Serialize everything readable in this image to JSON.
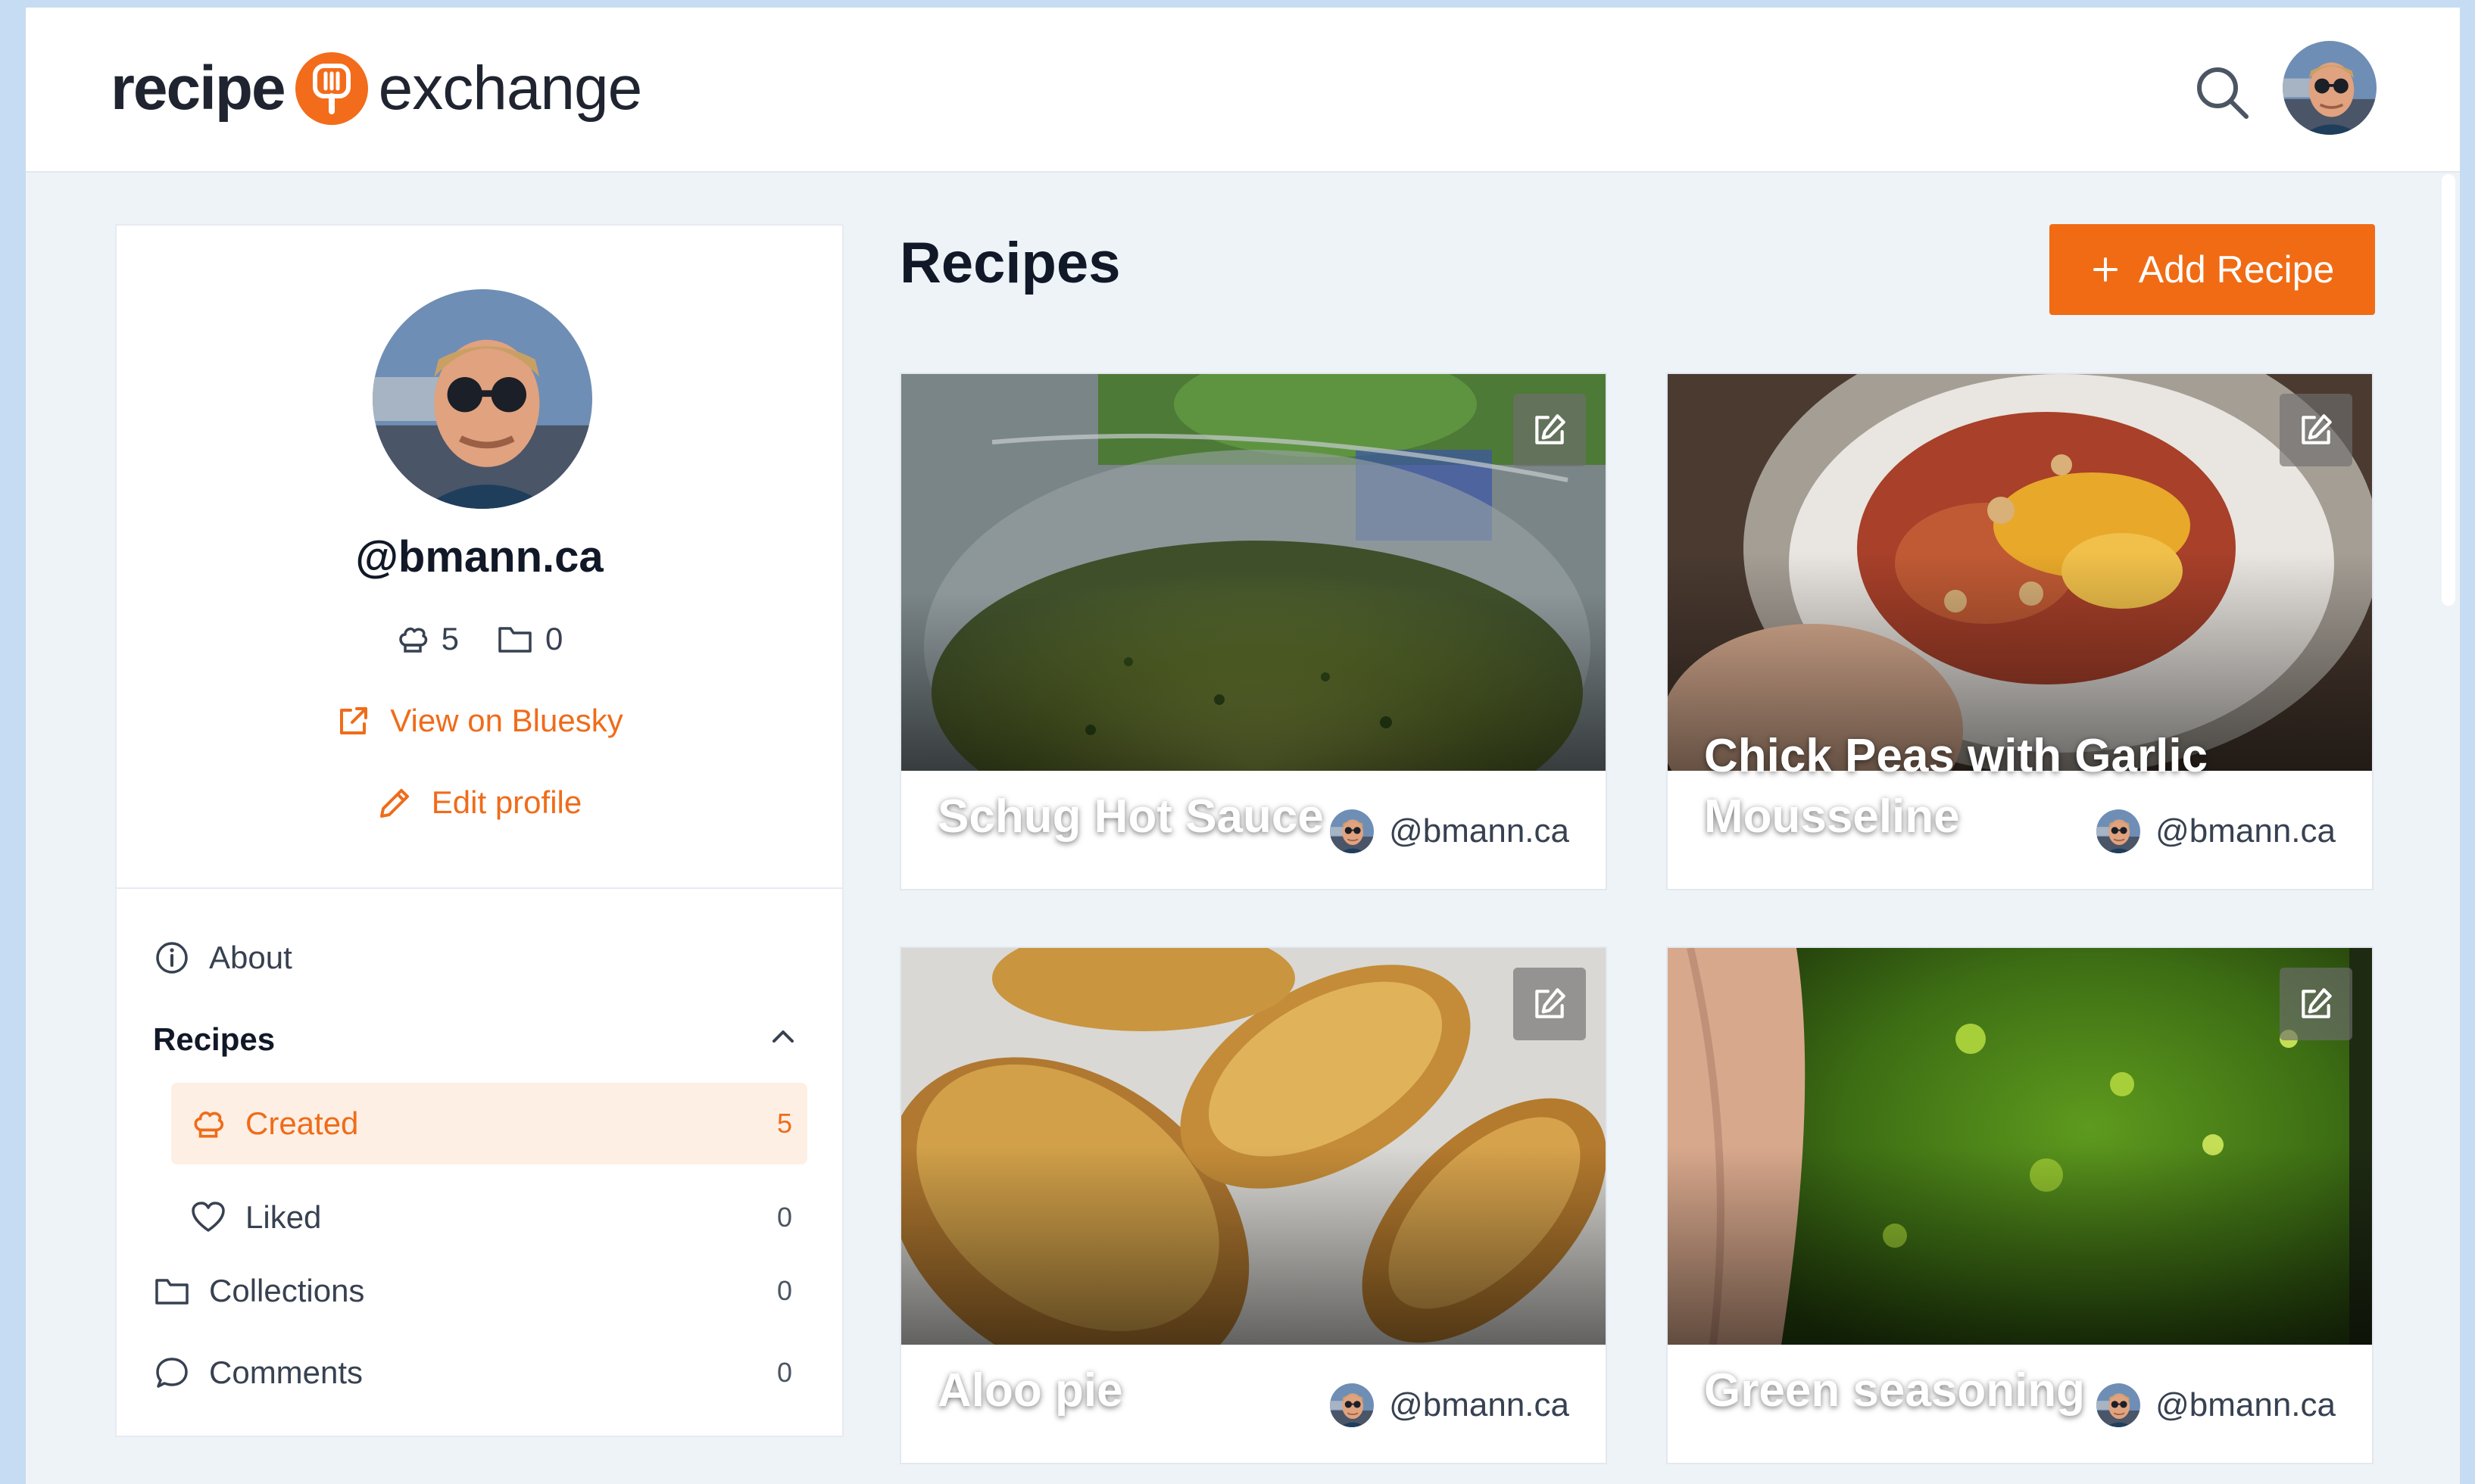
{
  "brand": {
    "word1": "recipe",
    "word2": "exchange",
    "accent": "#f06b14"
  },
  "header": {
    "search_icon": "search-icon",
    "avatar_icon": "user-avatar"
  },
  "profile": {
    "handle": "@bmann.ca",
    "recipes_count": "5",
    "collections_count": "0",
    "view_link": "View on Bluesky",
    "edit_link": "Edit profile"
  },
  "nav": {
    "about": "About",
    "recipes": "Recipes",
    "created": {
      "label": "Created",
      "count": "5"
    },
    "liked": {
      "label": "Liked",
      "count": "0"
    },
    "collections": {
      "label": "Collections",
      "count": "0"
    },
    "comments": {
      "label": "Comments",
      "count": "0"
    }
  },
  "main": {
    "title": "Recipes",
    "add_button": "Add Recipe"
  },
  "recipes": [
    {
      "title": "Schug Hot Sauce",
      "author": "@bmann.ca"
    },
    {
      "title": "Chick Peas with Garlic Mousseline",
      "author": "@bmann.ca"
    },
    {
      "title": "Aloo pie",
      "author": "@bmann.ca"
    },
    {
      "title": "Green seasoning",
      "author": "@bmann.ca"
    }
  ]
}
